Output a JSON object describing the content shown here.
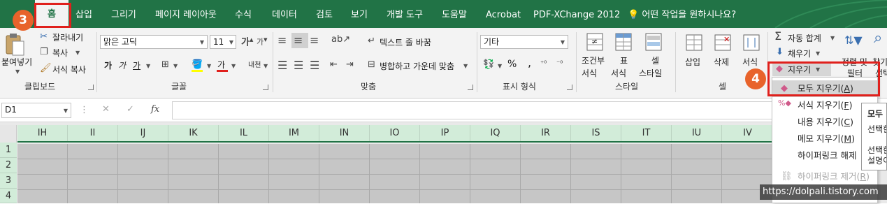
{
  "tabs": [
    {
      "label": "홈"
    },
    {
      "label": "삽입"
    },
    {
      "label": "그리기"
    },
    {
      "label": "페이지 레이아웃"
    },
    {
      "label": "수식"
    },
    {
      "label": "데이터"
    },
    {
      "label": "검토"
    },
    {
      "label": "보기"
    },
    {
      "label": "개발 도구"
    },
    {
      "label": "도움말"
    },
    {
      "label": "Acrobat"
    },
    {
      "label": "PDF-XChange 2012"
    }
  ],
  "tellme": "어떤 작업을 원하시나요?",
  "clipboard": {
    "paste": "붙여넣기",
    "cut": "잘라내기",
    "copy": "복사",
    "format_painter": "서식 복사",
    "group": "클립보드"
  },
  "font": {
    "name": "맑은 고딕",
    "size": "11",
    "group": "글꼴",
    "bold": "가",
    "italic": "가",
    "underline": "가",
    "font_color_letter": "가",
    "phonetic": "내천"
  },
  "alignment": {
    "wrap": "텍스트 줄 바꿈",
    "merge": "병합하고 가운데 맞춤",
    "group": "맞춤"
  },
  "number": {
    "format": "기타",
    "percent": "%",
    "comma": ",",
    "group": "표시 형식"
  },
  "styles": {
    "conditional": [
      "조건부",
      "서식"
    ],
    "table": [
      "표",
      "서식"
    ],
    "cell": [
      "셀",
      "스타일"
    ],
    "group": "스타일"
  },
  "cells": {
    "insert": "삽입",
    "delete": "삭제",
    "format": "서식",
    "group": "셀"
  },
  "editing": {
    "autosum": "자동 합계",
    "fill": "채우기",
    "clear": "지우기",
    "sort": [
      "정렬 및",
      "필터"
    ],
    "find": [
      "찾기",
      "선택"
    ]
  },
  "formula_bar": {
    "namebox": "D1",
    "fx": "fx"
  },
  "columns": [
    "IH",
    "II",
    "IJ",
    "IK",
    "IL",
    "IM",
    "IN",
    "IO",
    "IP",
    "IQ",
    "IR",
    "IS",
    "IT",
    "IU",
    "IV"
  ],
  "rows": [
    "1",
    "2",
    "3",
    "4"
  ],
  "clear_menu": [
    {
      "label": "모두 지우기",
      "key": "A"
    },
    {
      "label": "서식 지우기",
      "key": "F"
    },
    {
      "label": "내용 지우기",
      "key": "C"
    },
    {
      "label": "메모 지우기",
      "key": "M"
    },
    {
      "label": "하이퍼링크 해제",
      "key": ""
    },
    {
      "label": "하이퍼링크 제거",
      "key": "R"
    }
  ],
  "tooltip": {
    "title": "모두",
    "line1": "선택한",
    "line2": "선택한",
    "line3": "설명이"
  },
  "badges": {
    "step3": "3",
    "step4": "4"
  },
  "watermark": "https://dolpali.tistory.com",
  "colors": {
    "excel_green": "#217346",
    "highlight": "#e0201c",
    "badge": "#e8632b"
  }
}
